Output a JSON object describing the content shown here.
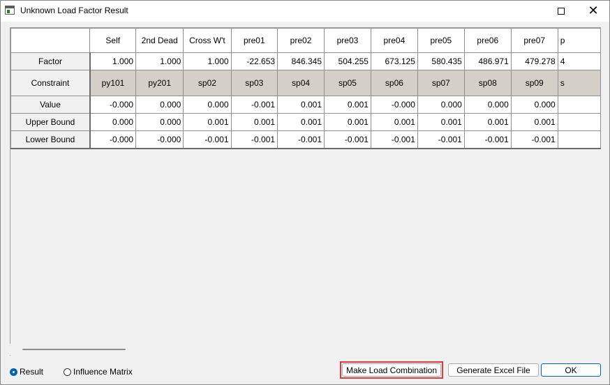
{
  "window": {
    "title": "Unknown Load Factor Result"
  },
  "grid": {
    "columns": [
      "Self",
      "2nd Dead",
      "Cross W't",
      "pre01",
      "pre02",
      "pre03",
      "pre04",
      "pre05",
      "pre06",
      "pre07",
      "p"
    ],
    "rows": {
      "factor": {
        "label": "Factor",
        "values": [
          "1.000",
          "1.000",
          "1.000",
          "-22.653",
          "846.345",
          "504.255",
          "673.125",
          "580.435",
          "486.971",
          "479.278",
          "4"
        ]
      },
      "constraint": {
        "label": "Constraint",
        "values": [
          "py101",
          "py201",
          "sp02",
          "sp03",
          "sp04",
          "sp05",
          "sp06",
          "sp07",
          "sp08",
          "sp09",
          "s"
        ]
      },
      "value": {
        "label": "Value",
        "values": [
          "-0.000",
          "0.000",
          "0.000",
          "-0.001",
          "0.001",
          "0.001",
          "-0.000",
          "0.000",
          "0.000",
          "0.000",
          ""
        ]
      },
      "upper_bound": {
        "label": "Upper Bound",
        "values": [
          "0.000",
          "0.000",
          "0.001",
          "0.001",
          "0.001",
          "0.001",
          "0.001",
          "0.001",
          "0.001",
          "0.001",
          ""
        ]
      },
      "lower_bound": {
        "label": "Lower Bound",
        "values": [
          "-0.000",
          "-0.000",
          "-0.001",
          "-0.001",
          "-0.001",
          "-0.001",
          "-0.001",
          "-0.001",
          "-0.001",
          "-0.001",
          ""
        ]
      }
    }
  },
  "footer": {
    "radio_result": {
      "label": "Result",
      "checked": true
    },
    "radio_influence": {
      "label": "Influence Matrix",
      "checked": false
    },
    "make_label": "Make Load Combination",
    "excel_label": "Generate Excel File",
    "ok_label": "OK",
    "highlight_color": "#e0393e",
    "accent_color": "#0063b1"
  }
}
